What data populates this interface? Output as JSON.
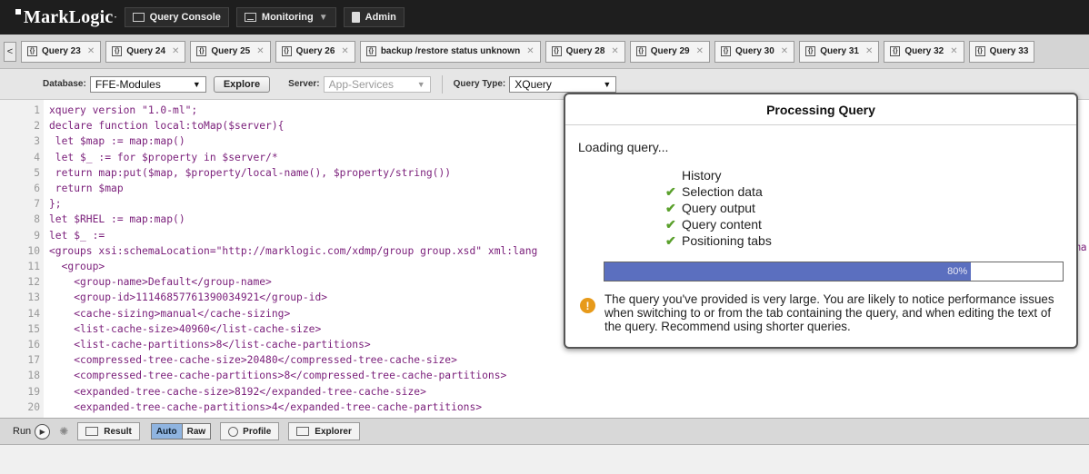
{
  "topnav": {
    "logo": "MarkLogic",
    "buttons": [
      {
        "label": "Query Console"
      },
      {
        "label": "Monitoring"
      },
      {
        "label": "Admin"
      }
    ]
  },
  "tabs": [
    "Query 23",
    "Query 24",
    "Query 25",
    "Query 26",
    "backup /restore status unknown",
    "Query 28",
    "Query 29",
    "Query 30",
    "Query 31",
    "Query 32",
    "Query 33"
  ],
  "toolbar": {
    "database_label": "Database:",
    "database_value": "FFE-Modules",
    "explore_label": "Explore",
    "server_label": "Server:",
    "server_value": "App-Services",
    "query_type_label": "Query Type:",
    "query_type_value": "XQuery"
  },
  "editor": {
    "lines": [
      {
        "n": "1",
        "code": "xquery version \"1.0-ml\";"
      },
      {
        "n": "2",
        "code": "declare function local:toMap($server){"
      },
      {
        "n": "3",
        "code": " let $map := map:map()"
      },
      {
        "n": "4",
        "code": " let $_ := for $property in $server/*"
      },
      {
        "n": "5",
        "code": " return map:put($map, $property/local-name(), $property/string())"
      },
      {
        "n": "6",
        "code": " return $map"
      },
      {
        "n": "7",
        "code": "};"
      },
      {
        "n": "8",
        "code": "let $RHEL := map:map()"
      },
      {
        "n": "9",
        "code": "let $_ :="
      },
      {
        "n": "10",
        "code": "<groups xsi:schemaLocation=\"http://marklogic.com/xdmp/group group.xsd\" xml:lang"
      },
      {
        "n": "11",
        "code": "  <group>"
      },
      {
        "n": "12",
        "code": "    <group-name>Default</group-name>"
      },
      {
        "n": "13",
        "code": "    <group-id>11146857761390034921</group-id>"
      },
      {
        "n": "14",
        "code": "    <cache-sizing>manual</cache-sizing>"
      },
      {
        "n": "15",
        "code": "    <list-cache-size>40960</list-cache-size>"
      },
      {
        "n": "16",
        "code": "    <list-cache-partitions>8</list-cache-partitions>"
      },
      {
        "n": "17",
        "code": "    <compressed-tree-cache-size>20480</compressed-tree-cache-size>"
      },
      {
        "n": "18",
        "code": "    <compressed-tree-cache-partitions>8</compressed-tree-cache-partitions>"
      },
      {
        "n": "19",
        "code": "    <expanded-tree-cache-size>8192</expanded-tree-cache-size>"
      },
      {
        "n": "20",
        "code": "    <expanded-tree-cache-partitions>4</expanded-tree-cache-partitions>"
      }
    ],
    "line10_tail": "ma"
  },
  "bottom": {
    "run_label": "Run",
    "result_label": "Result",
    "auto_label": "Auto",
    "raw_label": "Raw",
    "profile_label": "Profile",
    "explorer_label": "Explorer"
  },
  "modal": {
    "title": "Processing Query",
    "loading": "Loading query...",
    "steps": [
      {
        "label": "History",
        "done": false
      },
      {
        "label": "Selection data",
        "done": true
      },
      {
        "label": "Query output",
        "done": true
      },
      {
        "label": "Query content",
        "done": true
      },
      {
        "label": "Positioning tabs",
        "done": true
      }
    ],
    "progress_label": "80%",
    "progress_value": 0.8,
    "warning": "The query you've provided is very large. You are likely to notice performance issues when switching to or from the tab containing the query, and when editing the text of the query. Recommend using shorter queries."
  },
  "colors": {
    "progress_fill": "#5b6fbf",
    "check": "#5aa02c",
    "warning": "#e79a1a"
  }
}
